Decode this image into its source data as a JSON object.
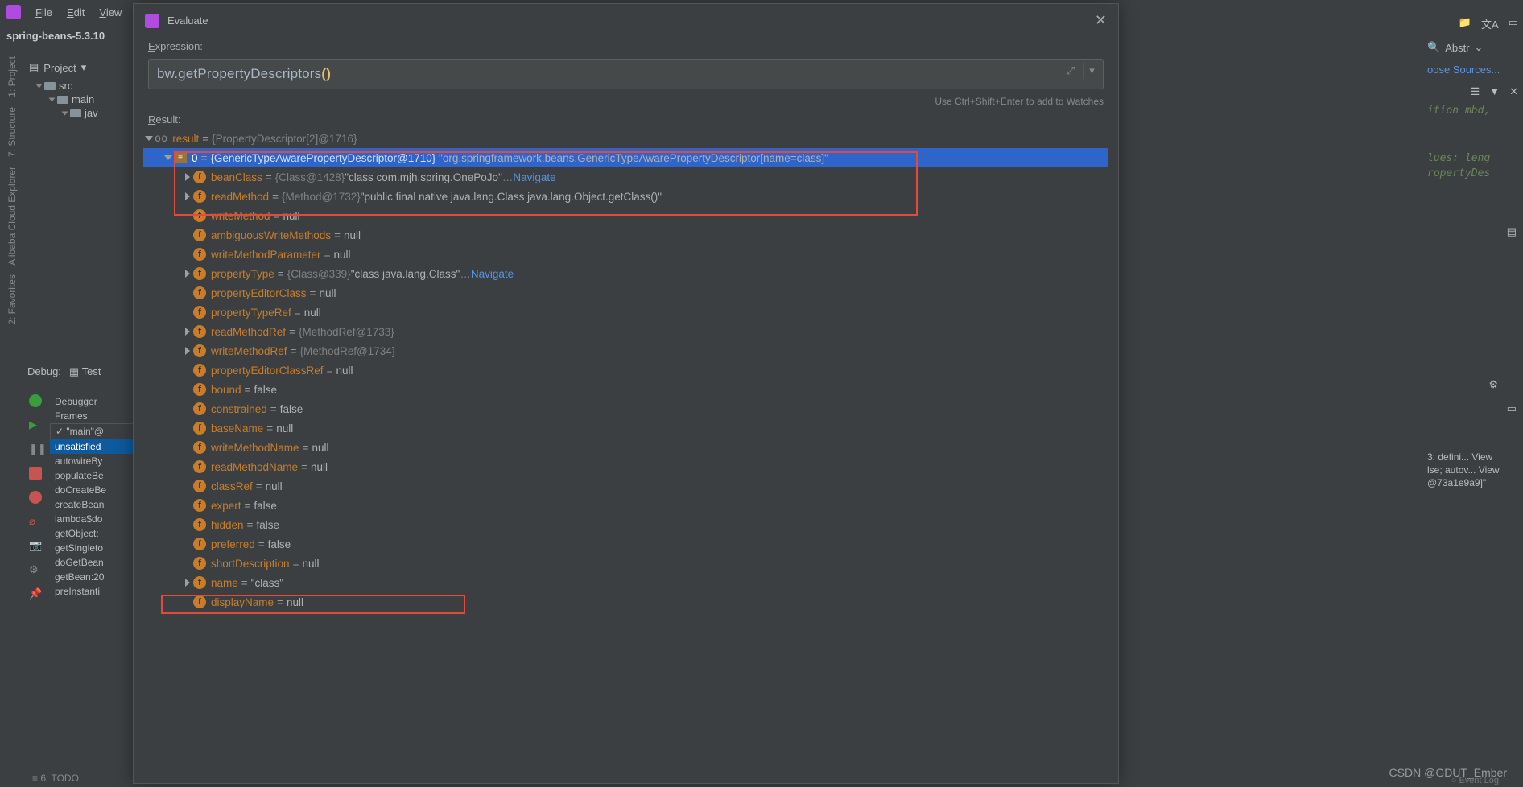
{
  "menubar": {
    "items": [
      "File",
      "Edit",
      "View"
    ]
  },
  "project_title": "spring-beans-5.3.10",
  "project_panel": {
    "header": "Project",
    "tree": [
      "src",
      "main",
      "jav"
    ]
  },
  "sidebars": {
    "left": [
      "1: Project",
      "7: Structure",
      "Alibaba Cloud Explorer",
      "2: Favorites"
    ]
  },
  "debug": {
    "label": "Debug:",
    "tab": "Test",
    "tabs": [
      "Debugger"
    ],
    "frames_label": "Frames",
    "thread": "\"main\"@",
    "stack": [
      "unsatisfied",
      "autowireBy",
      "populateBe",
      "doCreateBe",
      "createBean",
      "lambda$do",
      "getObject:",
      "getSingleto",
      "doGetBean",
      "getBean:20",
      "preInstanti"
    ]
  },
  "dialog": {
    "title": "Evaluate",
    "expression_label": "Expression:",
    "expression_prefix": "bw.getPropertyDescriptors",
    "hint": "Use Ctrl+Shift+Enter to add to Watches",
    "result_label": "Result:"
  },
  "result": {
    "root": {
      "name": "result",
      "type": "{PropertyDescriptor[2]@1716}"
    },
    "item0": {
      "idx": "0",
      "type": "{GenericTypeAwarePropertyDescriptor@1710}",
      "value": "\"org.springframework.beans.GenericTypeAwarePropertyDescriptor[name=class]\""
    },
    "fields": [
      {
        "expand": true,
        "name": "beanClass",
        "grey": "{Class@1428}",
        "val": "\"class com.mjh.spring.OnePoJo\"",
        "link": "Navigate"
      },
      {
        "expand": true,
        "name": "readMethod",
        "grey": "{Method@1732}",
        "val": "\"public final native java.lang.Class java.lang.Object.getClass()\""
      },
      {
        "expand": false,
        "name": "writeMethod",
        "val": "null"
      },
      {
        "expand": false,
        "name": "ambiguousWriteMethods",
        "val": "null"
      },
      {
        "expand": false,
        "name": "writeMethodParameter",
        "val": "null"
      },
      {
        "expand": true,
        "name": "propertyType",
        "grey": "{Class@339}",
        "val": "\"class java.lang.Class\"",
        "link": "Navigate"
      },
      {
        "expand": false,
        "name": "propertyEditorClass",
        "val": "null"
      },
      {
        "expand": false,
        "name": "propertyTypeRef",
        "val": "null"
      },
      {
        "expand": true,
        "name": "readMethodRef",
        "grey": "{MethodRef@1733}"
      },
      {
        "expand": true,
        "name": "writeMethodRef",
        "grey": "{MethodRef@1734}"
      },
      {
        "expand": false,
        "name": "propertyEditorClassRef",
        "val": "null"
      },
      {
        "expand": false,
        "name": "bound",
        "val": "false"
      },
      {
        "expand": false,
        "name": "constrained",
        "val": "false"
      },
      {
        "expand": false,
        "name": "baseName",
        "val": "null"
      },
      {
        "expand": false,
        "name": "writeMethodName",
        "val": "null"
      },
      {
        "expand": false,
        "name": "readMethodName",
        "val": "null"
      },
      {
        "expand": false,
        "name": "classRef",
        "val": "null"
      },
      {
        "expand": false,
        "name": "expert",
        "val": "false"
      },
      {
        "expand": false,
        "name": "hidden",
        "val": "false"
      },
      {
        "expand": false,
        "name": "preferred",
        "val": "false"
      },
      {
        "expand": false,
        "name": "shortDescription",
        "val": "null"
      },
      {
        "expand": true,
        "name": "name",
        "val": "\"class\""
      },
      {
        "expand": false,
        "name": "displayName",
        "val": "null"
      }
    ]
  },
  "right": {
    "abstr": "Abstr",
    "choose": "oose Sources...",
    "snips": [
      "ition mbd,",
      "lues: leng",
      "ropertyDes"
    ],
    "log": [
      "3: defini... View",
      "lse; autov... View",
      "@73a1e9a9]\""
    ]
  },
  "footer": {
    "todo": "6: TODO",
    "eventlog": "Event Log",
    "watermark": "CSDN @GDUT_Ember"
  }
}
